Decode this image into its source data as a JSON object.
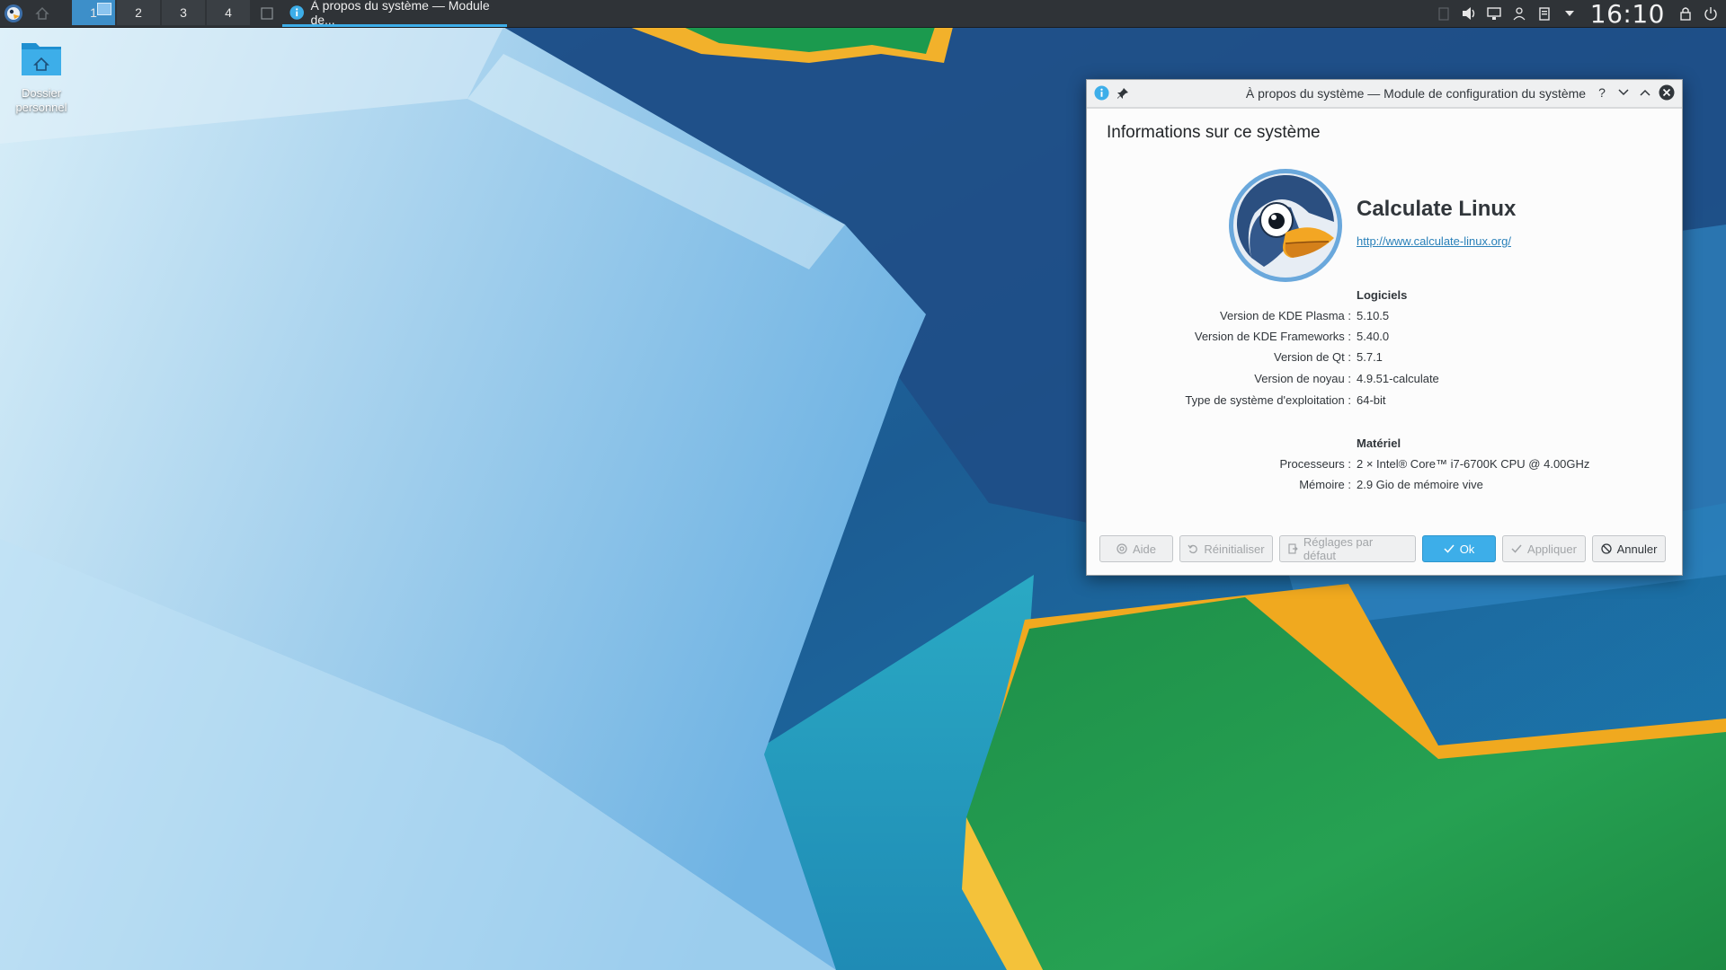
{
  "taskbar": {
    "pager": [
      "1",
      "2",
      "3",
      "4"
    ],
    "active_desktop": "1",
    "task_title": "À propos du système — Module de...",
    "clock": "16:10"
  },
  "desktop": {
    "icon_label_line1": "Dossier",
    "icon_label_line2": "personnel"
  },
  "dialog": {
    "title": "À propos du système — Module de configuration du système",
    "heading": "Informations sur ce système",
    "distro_name": "Calculate Linux",
    "distro_url": "http://www.calculate-linux.org/",
    "software": {
      "title": "Logiciels",
      "rows": [
        {
          "key": "Version de KDE Plasma :",
          "value": "5.10.5"
        },
        {
          "key": "Version de KDE Frameworks :",
          "value": "5.40.0"
        },
        {
          "key": "Version de Qt :",
          "value": "5.7.1"
        },
        {
          "key": "Version de noyau :",
          "value": "4.9.51-calculate"
        },
        {
          "key": "Type de système d'exploitation :",
          "value": "64-bit"
        }
      ]
    },
    "hardware": {
      "title": "Matériel",
      "rows": [
        {
          "key": "Processeurs :",
          "value": "2 × Intel® Core™ i7-6700K CPU @ 4.00GHz"
        },
        {
          "key": "Mémoire :",
          "value": "2.9 Gio de mémoire vive"
        }
      ]
    },
    "buttons": {
      "help": "Aide",
      "reset": "Réinitialiser",
      "defaults": "Réglages par défaut",
      "ok": "Ok",
      "apply": "Appliquer",
      "cancel": "Annuler"
    }
  },
  "colors": {
    "accent": "#3daee9",
    "panel": "#2f3337",
    "link": "#2980b9"
  }
}
